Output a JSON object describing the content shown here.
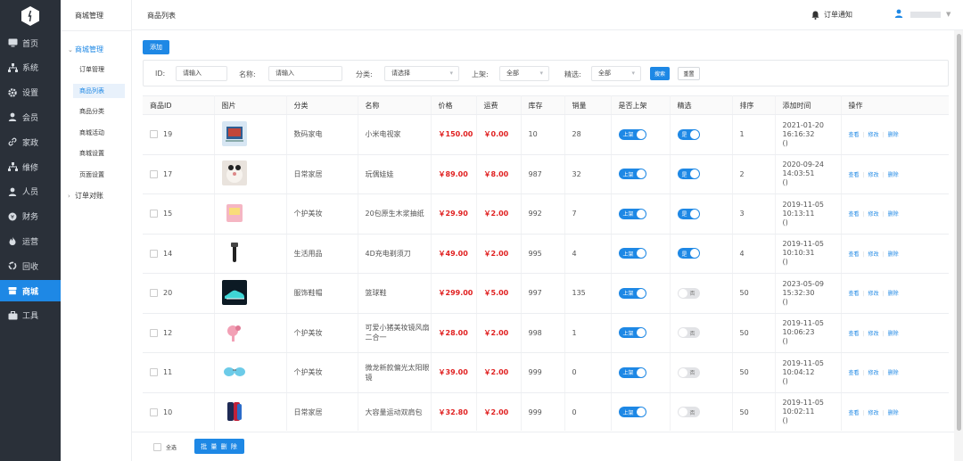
{
  "sidebar": {
    "items": [
      {
        "label": "首页",
        "icon": "monitor-icon"
      },
      {
        "label": "系统",
        "icon": "sitemap-icon"
      },
      {
        "label": "设置",
        "icon": "gear-icon"
      },
      {
        "label": "会员",
        "icon": "user-icon"
      },
      {
        "label": "家政",
        "icon": "link-icon"
      },
      {
        "label": "维修",
        "icon": "sitemap-icon"
      },
      {
        "label": "人员",
        "icon": "user-icon"
      },
      {
        "label": "财务",
        "icon": "yen-circle-icon"
      },
      {
        "label": "运营",
        "icon": "fire-icon"
      },
      {
        "label": "回收",
        "icon": "recycle-icon"
      },
      {
        "label": "商城",
        "icon": "shop-icon",
        "active": true
      },
      {
        "label": "工具",
        "icon": "briefcase-icon"
      }
    ]
  },
  "submenu": {
    "title": "商城管理",
    "group_open": "商城管理",
    "items": [
      "订单管理",
      "商品列表",
      "商品分类",
      "商城活动",
      "商城设置",
      "页面设置"
    ],
    "active_item": "商品列表",
    "group_closed": "订单对账"
  },
  "topbar": {
    "page_title": "商品列表",
    "notice_label": "订单通知"
  },
  "toolbar": {
    "add_label": "添加"
  },
  "filter": {
    "id_label": "ID:",
    "id_placeholder": "请输入",
    "name_label": "名称:",
    "name_placeholder": "请输入",
    "category_label": "分类:",
    "category_placeholder": "请选择",
    "shelf_label": "上架:",
    "shelf_value": "全部",
    "featured_label": "精选:",
    "featured_value": "全部",
    "search_label": "搜索",
    "reset_label": "重置"
  },
  "table": {
    "columns": [
      "商品ID",
      "图片",
      "分类",
      "名称",
      "价格",
      "运费",
      "库存",
      "销量",
      "是否上架",
      "精选",
      "排序",
      "添加时间",
      "操作"
    ],
    "rows": [
      {
        "id": "19",
        "image": "camera-photo",
        "category": "数码家电",
        "name": "小米电视家",
        "price": "￥150.00",
        "shipping": "￥0.00",
        "stock": "10",
        "sales": "28",
        "shelf": "上架",
        "featured": "是",
        "featured_on": true,
        "sort": "1",
        "time_date": "2021-01-20",
        "time_clock": "16:16:32",
        "time_extra": "()"
      },
      {
        "id": "17",
        "image": "doll-photo",
        "category": "日常家居",
        "name": "玩偶娃娃",
        "price": "￥89.00",
        "shipping": "￥8.00",
        "stock": "987",
        "sales": "32",
        "shelf": "上架",
        "featured": "是",
        "featured_on": true,
        "sort": "2",
        "time_date": "2020-09-24",
        "time_clock": "14:03:51",
        "time_extra": "()"
      },
      {
        "id": "15",
        "image": "tissue-photo",
        "category": "个护美妆",
        "name": "20包原生木浆抽纸",
        "price": "￥29.90",
        "shipping": "￥2.00",
        "stock": "992",
        "sales": "7",
        "shelf": "上架",
        "featured": "是",
        "featured_on": true,
        "sort": "3",
        "time_date": "2019-11-05",
        "time_clock": "10:13:11",
        "time_extra": "()"
      },
      {
        "id": "14",
        "image": "shaver-photo",
        "category": "生活用品",
        "name": "4D充电剃须刀",
        "price": "￥49.00",
        "shipping": "￥2.00",
        "stock": "995",
        "sales": "4",
        "shelf": "上架",
        "featured": "是",
        "featured_on": true,
        "sort": "4",
        "time_date": "2019-11-05",
        "time_clock": "10:10:31",
        "time_extra": "()"
      },
      {
        "id": "20",
        "image": "shoe-photo",
        "category": "服饰鞋帽",
        "name": "篮球鞋",
        "price": "￥299.00",
        "shipping": "￥5.00",
        "stock": "997",
        "sales": "135",
        "shelf": "上架",
        "featured": "否",
        "featured_on": false,
        "sort": "50",
        "time_date": "2023-05-09",
        "time_clock": "15:32:30",
        "time_extra": "()"
      },
      {
        "id": "12",
        "image": "mirror-fan-photo",
        "category": "个护美妆",
        "name": "可爱小猪美妆镜风扇二合一",
        "price": "￥28.00",
        "shipping": "￥2.00",
        "stock": "998",
        "sales": "1",
        "shelf": "上架",
        "featured": "否",
        "featured_on": false,
        "sort": "50",
        "time_date": "2019-11-05",
        "time_clock": "10:06:23",
        "time_extra": "()"
      },
      {
        "id": "11",
        "image": "sunglasses-photo",
        "category": "个护美妆",
        "name": "微龙新款偏光太阳眼镜",
        "price": "￥39.00",
        "shipping": "￥2.00",
        "stock": "999",
        "sales": "0",
        "shelf": "上架",
        "featured": "否",
        "featured_on": false,
        "sort": "50",
        "time_date": "2019-11-05",
        "time_clock": "10:04:12",
        "time_extra": "()"
      },
      {
        "id": "10",
        "image": "backpack-photo",
        "category": "日常家居",
        "name": "大容量运动双肩包",
        "price": "￥32.80",
        "shipping": "￥2.00",
        "stock": "999",
        "sales": "0",
        "shelf": "上架",
        "featured": "否",
        "featured_on": false,
        "sort": "50",
        "time_date": "2019-11-05",
        "time_clock": "10:02:11",
        "time_extra": "()"
      }
    ],
    "ops": {
      "view": "查看",
      "edit": "修改",
      "delete": "删除"
    }
  },
  "footer": {
    "select_all_label": "全选",
    "batch_delete_label": "批 量 删 除"
  },
  "colors": {
    "accent": "#1e88e5",
    "sidebar": "#2a3039",
    "price": "#e02020"
  }
}
